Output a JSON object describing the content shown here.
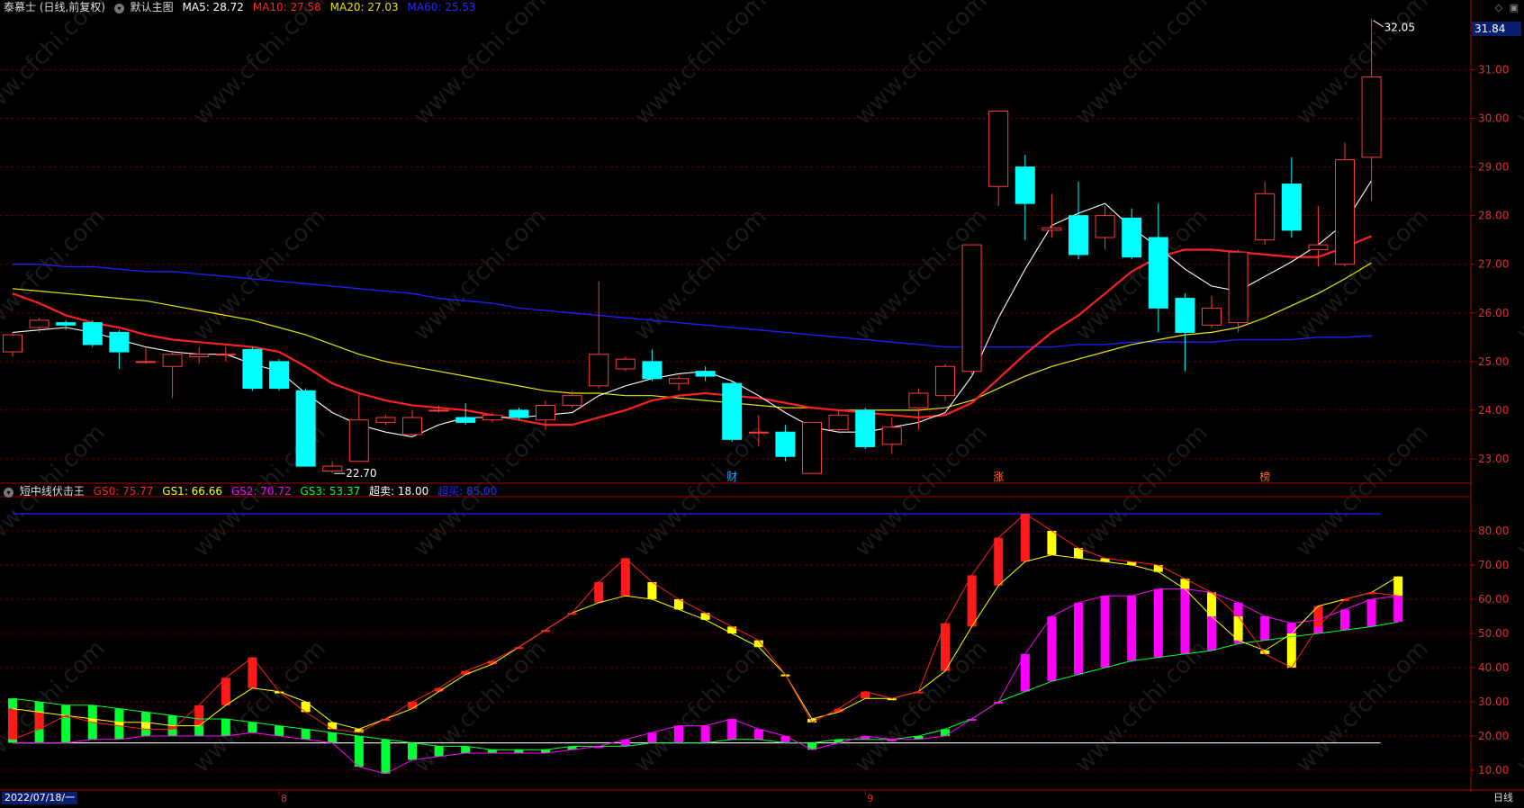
{
  "header": {
    "stock": "泰慕士 (日线,前复权)",
    "main_chart_label": "默认主图",
    "ma5": "MA5: 28.72",
    "ma10": "MA10: 27.58",
    "ma20": "MA20: 27.03",
    "ma60": "MA60: 25.53"
  },
  "sub_header": {
    "indicator": "短中线伏击王",
    "gs0": "GS0: 75.77",
    "gs1": "GS1: 66.66",
    "gs2": "GS2: 70.72",
    "gs3": "GS3: 53.37",
    "chaomai": "超卖: 18.00",
    "chaomai2": "超买: 85.00"
  },
  "colors": {
    "up": "#ff3a3a",
    "down": "#00ffff",
    "ma5": "#ffffff",
    "ma10": "#ff2020",
    "ma20": "#e6e600",
    "ma60": "#2020ff",
    "grid": "#5a0000",
    "axis": "#aa0000",
    "green": "#00ff33",
    "magenta": "#ff00ff",
    "yellow": "#ffff00"
  },
  "price_axis": [
    "23.00",
    "24.00",
    "25.00",
    "26.00",
    "27.00",
    "28.00",
    "29.00",
    "30.00",
    "31.00"
  ],
  "price_range": [
    22.5,
    32.1
  ],
  "current_price": "31.84",
  "high_label": "32.05",
  "low_label": "22.70",
  "sub_axis": [
    "10.00",
    "20.00",
    "30.00",
    "40.00",
    "50.00",
    "60.00",
    "70.00",
    "80.00"
  ],
  "sub_range": [
    5,
    90
  ],
  "markers": [
    "财",
    "涨",
    "榜"
  ],
  "date_label": "2022/07/18/一",
  "month_ticks": [
    "8",
    "9"
  ],
  "period_label": "日线",
  "watermark": "www.cfchi.com",
  "candles": [
    {
      "o": 25.2,
      "c": 25.55,
      "h": 25.6,
      "l": 25.1
    },
    {
      "o": 25.7,
      "c": 25.85,
      "h": 25.9,
      "l": 25.6
    },
    {
      "o": 25.8,
      "c": 25.75,
      "h": 25.85,
      "l": 25.65
    },
    {
      "o": 25.8,
      "c": 25.35,
      "h": 25.85,
      "l": 25.3
    },
    {
      "o": 25.6,
      "c": 25.2,
      "h": 25.65,
      "l": 24.85
    },
    {
      "o": 25.0,
      "c": 25.0,
      "h": 25.3,
      "l": 24.95
    },
    {
      "o": 24.9,
      "c": 25.15,
      "h": 25.2,
      "l": 24.25
    },
    {
      "o": 25.1,
      "c": 25.15,
      "h": 25.3,
      "l": 24.95
    },
    {
      "o": 25.15,
      "c": 25.15,
      "h": 25.3,
      "l": 25.0
    },
    {
      "o": 25.25,
      "c": 24.45,
      "h": 25.3,
      "l": 24.4
    },
    {
      "o": 25.0,
      "c": 24.45,
      "h": 25.05,
      "l": 24.4
    },
    {
      "o": 24.4,
      "c": 22.85,
      "h": 24.45,
      "l": 22.85
    },
    {
      "o": 22.75,
      "c": 22.85,
      "h": 22.95,
      "l": 22.7
    },
    {
      "o": 22.95,
      "c": 23.8,
      "h": 24.35,
      "l": 22.95
    },
    {
      "o": 23.75,
      "c": 23.85,
      "h": 23.9,
      "l": 23.7
    },
    {
      "o": 23.5,
      "c": 23.85,
      "h": 24.0,
      "l": 23.45
    },
    {
      "o": 24.0,
      "c": 24.0,
      "h": 24.1,
      "l": 23.95
    },
    {
      "o": 23.85,
      "c": 23.75,
      "h": 24.15,
      "l": 23.7
    },
    {
      "o": 23.8,
      "c": 23.9,
      "h": 23.95,
      "l": 23.75
    },
    {
      "o": 24.0,
      "c": 23.85,
      "h": 24.05,
      "l": 23.8
    },
    {
      "o": 23.8,
      "c": 24.1,
      "h": 24.2,
      "l": 23.6
    },
    {
      "o": 24.1,
      "c": 24.3,
      "h": 24.4,
      "l": 24.05
    },
    {
      "o": 24.5,
      "c": 25.15,
      "h": 26.65,
      "l": 24.45
    },
    {
      "o": 24.85,
      "c": 25.05,
      "h": 25.1,
      "l": 24.8
    },
    {
      "o": 25.0,
      "c": 24.65,
      "h": 25.25,
      "l": 24.6
    },
    {
      "o": 24.55,
      "c": 24.65,
      "h": 24.7,
      "l": 24.4
    },
    {
      "o": 24.8,
      "c": 24.7,
      "h": 24.9,
      "l": 24.6
    },
    {
      "o": 24.55,
      "c": 23.4,
      "h": 24.6,
      "l": 23.35
    },
    {
      "o": 23.55,
      "c": 23.55,
      "h": 23.9,
      "l": 23.25
    },
    {
      "o": 23.55,
      "c": 23.05,
      "h": 23.7,
      "l": 22.95
    },
    {
      "o": 22.7,
      "c": 23.75,
      "h": 23.75,
      "l": 22.7
    },
    {
      "o": 23.6,
      "c": 23.9,
      "h": 24.0,
      "l": 23.55
    },
    {
      "o": 24.0,
      "c": 23.25,
      "h": 24.05,
      "l": 23.2
    },
    {
      "o": 23.3,
      "c": 23.65,
      "h": 23.85,
      "l": 23.1
    },
    {
      "o": 24.05,
      "c": 24.35,
      "h": 24.45,
      "l": 23.6
    },
    {
      "o": 24.3,
      "c": 24.9,
      "h": 24.95,
      "l": 24.2
    },
    {
      "o": 24.8,
      "c": 27.4,
      "h": 27.4,
      "l": 24.7
    },
    {
      "o": 28.6,
      "c": 30.15,
      "h": 30.15,
      "l": 28.2
    },
    {
      "o": 29.0,
      "c": 28.25,
      "h": 29.25,
      "l": 27.5
    },
    {
      "o": 27.7,
      "c": 27.75,
      "h": 28.45,
      "l": 27.55
    },
    {
      "o": 28.0,
      "c": 27.2,
      "h": 28.7,
      "l": 27.1
    },
    {
      "o": 27.55,
      "c": 28.0,
      "h": 28.2,
      "l": 27.3
    },
    {
      "o": 27.95,
      "c": 27.15,
      "h": 28.15,
      "l": 27.1
    },
    {
      "o": 27.55,
      "c": 26.1,
      "h": 28.25,
      "l": 25.6
    },
    {
      "o": 26.3,
      "c": 25.6,
      "h": 26.4,
      "l": 24.8
    },
    {
      "o": 25.75,
      "c": 26.1,
      "h": 26.35,
      "l": 25.7
    },
    {
      "o": 25.8,
      "c": 27.25,
      "h": 27.3,
      "l": 25.6
    },
    {
      "o": 27.5,
      "c": 28.45,
      "h": 28.7,
      "l": 27.4
    },
    {
      "o": 28.65,
      "c": 27.7,
      "h": 29.2,
      "l": 27.55
    },
    {
      "o": 27.3,
      "c": 27.4,
      "h": 28.2,
      "l": 26.95
    },
    {
      "o": 27.0,
      "c": 29.15,
      "h": 29.5,
      "l": 26.95
    },
    {
      "o": 29.2,
      "c": 30.85,
      "h": 32.05,
      "l": 28.3
    }
  ],
  "ma5": [
    25.6,
    25.65,
    25.7,
    25.6,
    25.45,
    25.3,
    25.2,
    25.15,
    25.15,
    24.95,
    24.8,
    24.35,
    23.95,
    23.7,
    23.55,
    23.45,
    23.7,
    23.85,
    23.85,
    23.85,
    23.9,
    23.95,
    24.3,
    24.5,
    24.65,
    24.75,
    24.8,
    24.6,
    24.3,
    23.95,
    23.65,
    23.55,
    23.55,
    23.65,
    23.75,
    23.95,
    24.7,
    25.9,
    26.9,
    27.8,
    28.05,
    28.25,
    27.75,
    27.35,
    26.9,
    26.55,
    26.45,
    26.75,
    27.05,
    27.4,
    27.85,
    28.72
  ],
  "ma10": [
    26.4,
    26.2,
    25.95,
    25.8,
    25.7,
    25.55,
    25.45,
    25.4,
    25.35,
    25.3,
    25.2,
    24.9,
    24.55,
    24.35,
    24.2,
    24.1,
    24.05,
    24.0,
    23.9,
    23.8,
    23.7,
    23.7,
    23.85,
    24.0,
    24.2,
    24.3,
    24.35,
    24.3,
    24.25,
    24.15,
    24.05,
    24.0,
    23.95,
    23.9,
    23.85,
    23.9,
    24.15,
    24.65,
    25.15,
    25.6,
    25.95,
    26.4,
    26.85,
    27.15,
    27.3,
    27.3,
    27.25,
    27.2,
    27.15,
    27.15,
    27.35,
    27.58
  ],
  "ma20": [
    26.5,
    26.45,
    26.4,
    26.35,
    26.3,
    26.25,
    26.15,
    26.05,
    25.95,
    25.85,
    25.7,
    25.55,
    25.35,
    25.15,
    25.0,
    24.9,
    24.8,
    24.7,
    24.6,
    24.5,
    24.4,
    24.35,
    24.35,
    24.3,
    24.3,
    24.25,
    24.2,
    24.15,
    24.1,
    24.05,
    24.05,
    24.0,
    24.0,
    24.0,
    24.0,
    24.05,
    24.2,
    24.45,
    24.7,
    24.9,
    25.05,
    25.2,
    25.35,
    25.45,
    25.55,
    25.6,
    25.7,
    25.9,
    26.15,
    26.4,
    26.7,
    27.03
  ],
  "ma60": [
    27.0,
    27.0,
    26.95,
    26.95,
    26.9,
    26.85,
    26.85,
    26.8,
    26.75,
    26.7,
    26.65,
    26.6,
    26.55,
    26.5,
    26.45,
    26.4,
    26.3,
    26.25,
    26.2,
    26.1,
    26.05,
    26.0,
    25.95,
    25.9,
    25.85,
    25.8,
    25.75,
    25.7,
    25.65,
    25.6,
    25.55,
    25.5,
    25.45,
    25.4,
    25.35,
    25.3,
    25.3,
    25.3,
    25.3,
    25.3,
    25.35,
    25.35,
    25.4,
    25.4,
    25.4,
    25.4,
    25.45,
    25.45,
    25.45,
    25.5,
    25.5,
    25.53
  ],
  "gs0": [
    19,
    22,
    26,
    24,
    23,
    22,
    22,
    29,
    37,
    43,
    33,
    27,
    22,
    21,
    25,
    30,
    34,
    39,
    42,
    46,
    51,
    56,
    65,
    72,
    65,
    60,
    56,
    52,
    48,
    38,
    24,
    28,
    33,
    31,
    33,
    53,
    67,
    78,
    85,
    80,
    75,
    72,
    71,
    70,
    66,
    62,
    55,
    44,
    40,
    52,
    60,
    62,
    61,
    72,
    75.77
  ],
  "gs1": [
    28,
    27,
    26,
    25,
    24,
    24,
    23,
    23,
    29,
    34,
    33,
    30,
    24,
    22,
    25,
    28,
    33,
    38,
    41,
    46,
    51,
    56,
    59,
    61,
    60,
    57,
    54,
    50,
    46,
    38,
    25,
    27,
    31,
    31,
    33,
    39,
    52,
    64,
    71,
    73,
    72,
    71,
    70,
    68,
    63,
    55,
    48,
    45,
    50,
    58,
    60,
    62,
    66.66
  ],
  "gs2": [
    18,
    18,
    18,
    19,
    19,
    20,
    20,
    20,
    20,
    21,
    20,
    19,
    18,
    11,
    9,
    13,
    14,
    15,
    15,
    15,
    15,
    16,
    17,
    19,
    21,
    23,
    23,
    25,
    22,
    20,
    16,
    18,
    20,
    19,
    19,
    20,
    25,
    30,
    44,
    55,
    59,
    61,
    61,
    63,
    63,
    62,
    59,
    55,
    53,
    54,
    57,
    60,
    61,
    65,
    70.72
  ],
  "gs3": [
    31,
    30,
    29,
    29,
    28,
    27,
    26,
    25,
    25,
    24,
    23,
    22,
    21,
    20,
    19,
    18,
    17,
    17,
    16,
    16,
    16,
    17,
    17,
    17,
    18,
    18,
    18,
    19,
    19,
    18,
    18,
    19,
    19,
    19,
    20,
    22,
    25,
    30,
    33,
    36,
    38,
    40,
    42,
    43,
    44,
    45,
    47,
    48,
    49,
    50,
    51,
    52,
    53.37
  ]
}
